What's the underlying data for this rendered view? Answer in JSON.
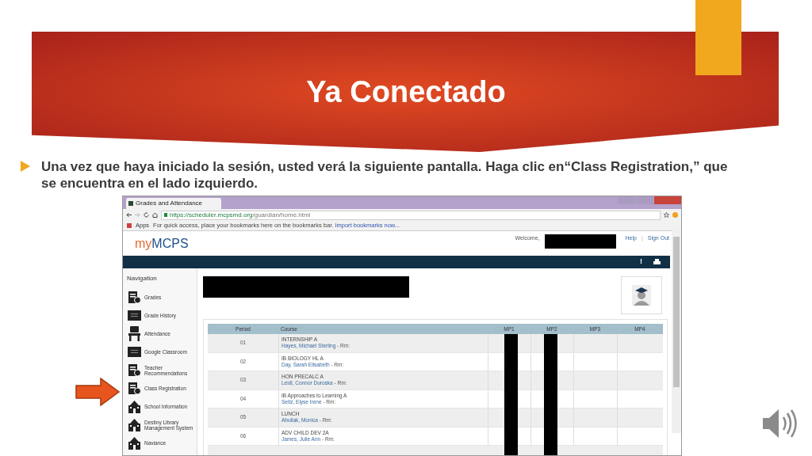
{
  "slide": {
    "title": "Ya Conectado",
    "bullet": "Una vez que haya iniciado la sesión, usted verá la siguiente pantalla. Haga clic en“Class Registration,” que se encuentra en el lado izquierdo."
  },
  "browser": {
    "tab": "Grades and Attendance",
    "url_host": "https://scheduler.mcpsmd.org",
    "url_path": "/guardian/home.html",
    "apps": "Apps",
    "bookmarks_hint": "For quick access, place your bookmarks here on the bookmarks bar.",
    "import_link": "Import bookmarks now..."
  },
  "site": {
    "logo_a": "my",
    "logo_b": "MCPS",
    "welcome": "Welcome,",
    "help": "Help",
    "separator": "|",
    "sign_out": "Sign Out",
    "alert": "!"
  },
  "navigation": {
    "title": "Navigation",
    "items": [
      {
        "label": "Grades",
        "kind": "document"
      },
      {
        "label": "Grade History",
        "kind": "board"
      },
      {
        "label": "Attendance",
        "kind": "chair"
      },
      {
        "label": "Google Classroom",
        "kind": "board"
      },
      {
        "label": "Teacher Recommendations",
        "kind": "document"
      },
      {
        "label": "Class Registration",
        "kind": "document"
      },
      {
        "label": "School Information",
        "kind": "school"
      },
      {
        "label": "Destiny Library Management System",
        "kind": "school"
      },
      {
        "label": "Naviance",
        "kind": "school"
      }
    ]
  },
  "table": {
    "columns": [
      "Period",
      "Course",
      "MP1",
      "MP2",
      "MP3",
      "MP4"
    ],
    "rows": [
      {
        "period": "01",
        "course": "INTERNSHIP A",
        "teacher": "Hayes, Michael Sterling",
        "room": " - Rm:"
      },
      {
        "period": "02",
        "course": "IB BIOLOGY HL A",
        "teacher": "Day, Sarah Elisabeth",
        "room": " - Rm:"
      },
      {
        "period": "03",
        "course": "HON PRECALC A",
        "teacher": "Leidl, Connor Duroska",
        "room": " - Rm:"
      },
      {
        "period": "04",
        "course": "IB Approaches to Learning A",
        "teacher": "Seitz, Elyse Irene",
        "room": " - Rm:"
      },
      {
        "period": "05",
        "course": "LUNCH",
        "teacher": "Abuliak, Monica",
        "room": " - Rm:"
      },
      {
        "period": "06",
        "course": "ADV CHILD DEV 2A",
        "teacher": "James, Julie Ann",
        "room": " - Rm:"
      }
    ]
  }
}
